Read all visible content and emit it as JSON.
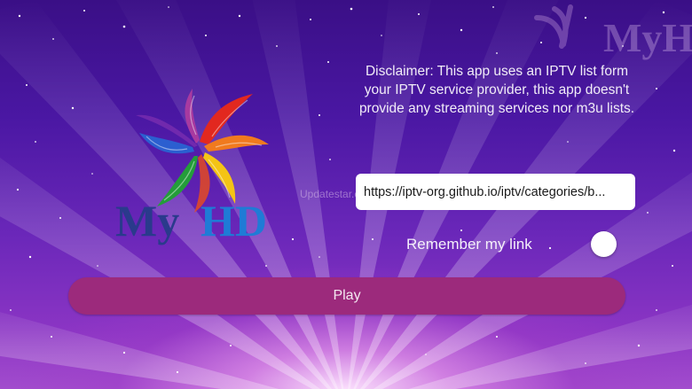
{
  "app": {
    "logo_text_1": "My",
    "logo_text_2": "HD",
    "watermark": "Updatestar.com",
    "corner_watermark_text": "MyHD"
  },
  "disclaimer": {
    "text": "Disclaimer: This app uses an IPTV list form your IPTV service provider, this app doesn't provide any streaming services nor m3u lists."
  },
  "url_field": {
    "value": "https://iptv-org.github.io/iptv/categories/b..."
  },
  "remember": {
    "label": "Remember my link",
    "checked": false
  },
  "play": {
    "label": "Play"
  },
  "colors": {
    "play_button": "#9c2a7c",
    "background_top": "#3a0f86",
    "background_bottom": "#a24ccd"
  }
}
